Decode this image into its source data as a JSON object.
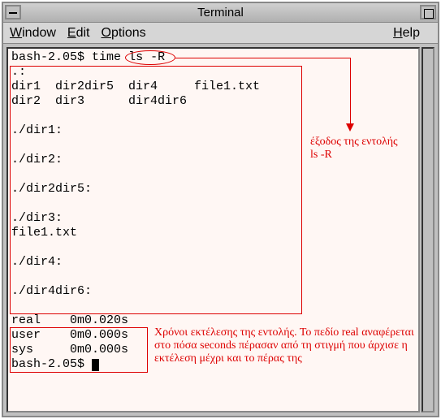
{
  "window": {
    "title": "Terminal"
  },
  "menubar": {
    "window": "Window",
    "edit": "Edit",
    "options": "Options",
    "help": "Help"
  },
  "terminal": {
    "prompt": "bash-2.05$",
    "command_prefix": "time",
    "command_arg": "ls -R",
    "output": {
      "rows": [
        ".:",
        "dir1  dir2dir5  dir4     file1.txt",
        "dir2  dir3      dir4dir6",
        "",
        "./dir1:",
        "",
        "./dir2:",
        "",
        "./dir2dir5:",
        "",
        "./dir3:",
        "file1.txt",
        "",
        "./dir4:",
        "",
        "./dir4dir6:"
      ]
    },
    "times": {
      "real": "real    0m0.020s",
      "user": "user    0m0.000s",
      "sys": "sys     0m0.000s"
    },
    "prompt2": "bash-2.05$ "
  },
  "annotations": {
    "output_label_line1": "έξοδος της εντολής",
    "output_label_line2": "ls -R",
    "times_label": "Χρόνοι εκτέλεσης της εντολής. Το πεδίο real αναφέρεται στο πόσα seconds πέρασαν από τη στιγμή  που άρχισε η εκτέλεση μέχρι και το πέρας της"
  }
}
